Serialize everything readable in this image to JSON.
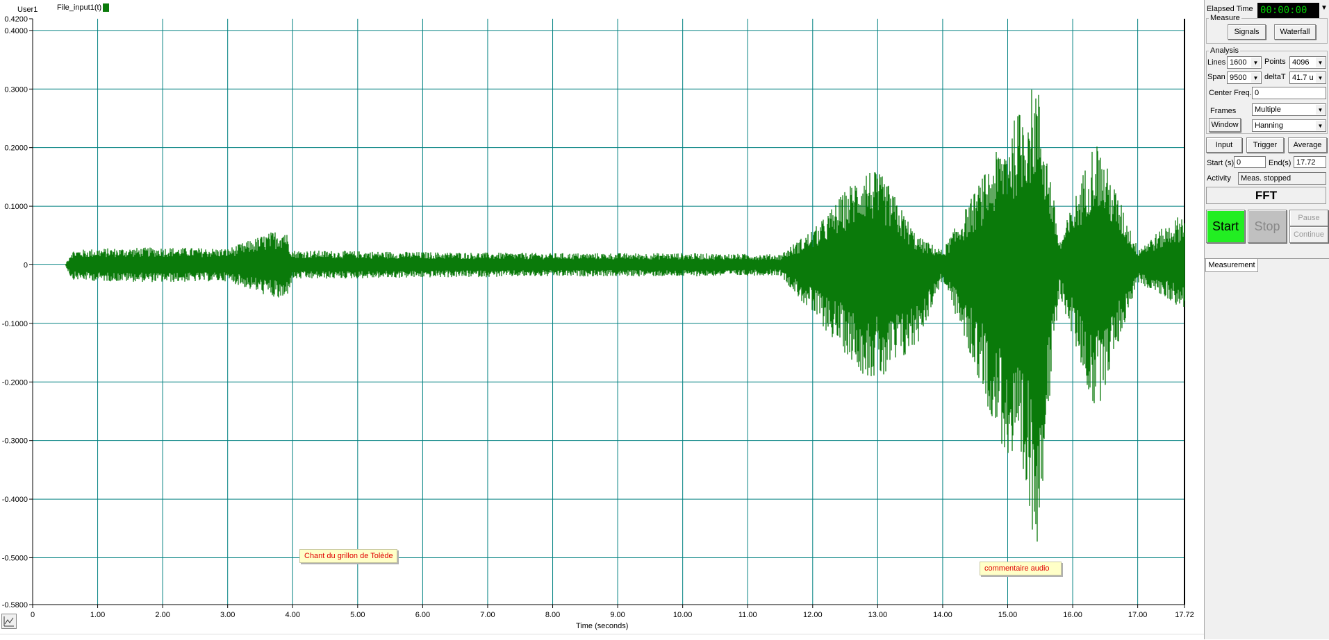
{
  "header": {
    "user": "User1",
    "trace_name": "File_input1(t)"
  },
  "plot": {
    "x_axis_title": "Time (seconds)",
    "x_ticks": [
      "0",
      "1.00",
      "2.00",
      "3.00",
      "4.00",
      "5.00",
      "6.00",
      "7.00",
      "8.00",
      "9.00",
      "10.00",
      "11.00",
      "12.00",
      "13.00",
      "14.00",
      "15.00",
      "16.00",
      "17.00",
      "17.72"
    ],
    "y_ticks": [
      "0.4200",
      "0.4000",
      "0.3000",
      "0.2000",
      "0.1000",
      "0",
      "-0.1000",
      "-0.2000",
      "-0.3000",
      "-0.4000",
      "-0.5000",
      "-0.5800"
    ],
    "annotation_1": "Chant du grillon de Tolède",
    "annotation_2": "commentaire audio",
    "trace_color": "#0a7a0a",
    "grid_color": "#008080"
  },
  "chart_data": {
    "type": "line",
    "xlabel": "Time (seconds)",
    "ylabel": "",
    "xlim": [
      0,
      17.72
    ],
    "ylim": [
      -0.58,
      0.42
    ],
    "series": [
      {
        "name": "File_input1(t)",
        "envelope": [
          {
            "t": 0.0,
            "max": 0.0,
            "min": 0.0
          },
          {
            "t": 0.5,
            "max": 0.0,
            "min": 0.0
          },
          {
            "t": 0.6,
            "max": 0.025,
            "min": -0.025
          },
          {
            "t": 1.0,
            "max": 0.028,
            "min": -0.028
          },
          {
            "t": 2.0,
            "max": 0.03,
            "min": -0.03
          },
          {
            "t": 3.0,
            "max": 0.028,
            "min": -0.028
          },
          {
            "t": 3.88,
            "max": 0.065,
            "min": -0.065
          },
          {
            "t": 4.0,
            "max": 0.025,
            "min": -0.025
          },
          {
            "t": 6.0,
            "max": 0.022,
            "min": -0.022
          },
          {
            "t": 8.0,
            "max": 0.02,
            "min": -0.02
          },
          {
            "t": 10.0,
            "max": 0.02,
            "min": -0.02
          },
          {
            "t": 11.5,
            "max": 0.018,
            "min": -0.018
          },
          {
            "t": 12.1,
            "max": 0.07,
            "min": -0.1
          },
          {
            "t": 12.8,
            "max": 0.17,
            "min": -0.19
          },
          {
            "t": 13.1,
            "max": 0.15,
            "min": -0.2
          },
          {
            "t": 13.6,
            "max": 0.05,
            "min": -0.14
          },
          {
            "t": 14.0,
            "max": 0.025,
            "min": -0.025
          },
          {
            "t": 15.45,
            "max": 0.32,
            "min": -0.48
          },
          {
            "t": 15.8,
            "max": 0.04,
            "min": -0.05
          },
          {
            "t": 16.35,
            "max": 0.22,
            "min": -0.26
          },
          {
            "t": 17.0,
            "max": 0.03,
            "min": -0.03
          },
          {
            "t": 17.7,
            "max": 0.09,
            "min": -0.075
          }
        ]
      }
    ],
    "grid": true
  },
  "panel": {
    "elapsed_label": "Elapsed Time",
    "elapsed_value": "00:00:00",
    "measure_title": "Measure",
    "signals_btn": "Signals",
    "waterfall_btn": "Waterfall",
    "analysis_title": "Analysis",
    "lines_label": "Lines",
    "lines_value": "1600",
    "points_label": "Points",
    "points_value": "4096",
    "span_label": "Span",
    "span_value": "9500",
    "deltat_label": "deltaT",
    "deltat_value": "41.7 u",
    "center_label": "Center Freq.",
    "center_value": "0",
    "frames_label": "Frames",
    "frames_value": "Multiple",
    "window_btn": "Window",
    "window_value": "Hanning",
    "input_btn": "Input",
    "trigger_btn": "Trigger",
    "average_btn": "Average",
    "start_label": "Start (s)",
    "start_value": "0",
    "end_label": "End(s)",
    "end_value": "17.72",
    "activity_label": "Activity",
    "activity_value": "Meas. stopped",
    "mode_title": "FFT",
    "start_btn": "Start",
    "stop_btn": "Stop",
    "pause_btn": "Pause",
    "continue_btn": "Continue",
    "measurement_tab": "Measurement",
    "start_color": "#22ee22",
    "stop_color": "#c0c0c0"
  }
}
